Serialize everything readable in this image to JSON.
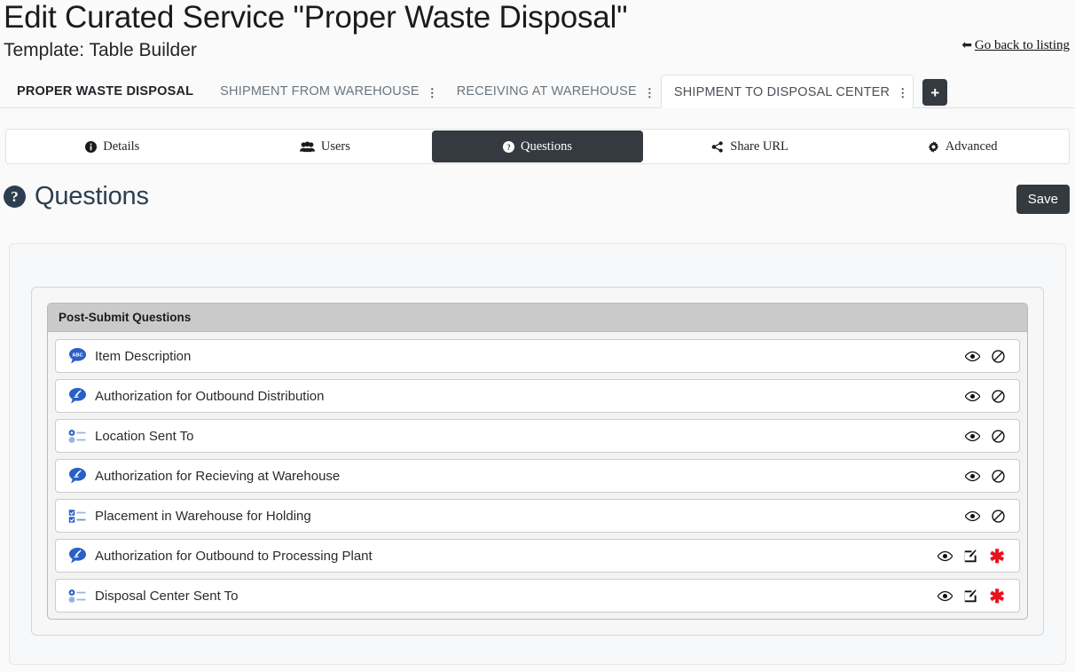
{
  "header": {
    "title": "Edit Curated Service \"Proper Waste Disposal\"",
    "subtitle": "Template: Table Builder",
    "go_back_label": "Go back to listing",
    "back_arrow_icon": "arrow-left-icon"
  },
  "tabs": {
    "items": [
      {
        "label": "PROPER WASTE DISPOSAL",
        "kebab": false,
        "style": "bold",
        "active": false
      },
      {
        "label": "SHIPMENT FROM WAREHOUSE",
        "kebab": true,
        "style": "muted",
        "active": false
      },
      {
        "label": "RECEIVING AT WAREHOUSE",
        "kebab": true,
        "style": "muted",
        "active": false
      },
      {
        "label": "SHIPMENT TO DISPOSAL CENTER",
        "kebab": true,
        "style": "muted",
        "active": true
      }
    ],
    "kebab_glyph": "⋮",
    "add_tab_label": "+",
    "add_tab_icon": "plus-icon"
  },
  "nav": {
    "items": [
      {
        "label": "Details",
        "icon": "info-circle-icon",
        "active": false
      },
      {
        "label": "Users",
        "icon": "users-icon",
        "active": false
      },
      {
        "label": "Questions",
        "icon": "question-circle-icon",
        "active": true
      },
      {
        "label": "Share URL",
        "icon": "share-icon",
        "active": false
      },
      {
        "label": "Advanced",
        "icon": "gear-icon",
        "active": false
      }
    ]
  },
  "section": {
    "title": "Questions",
    "badge_icon": "question-circle-icon",
    "badge_glyph": "?",
    "save_label": "Save"
  },
  "panel": {
    "header": "Post-Submit Questions",
    "rows": [
      {
        "label": "Item Description",
        "icon": "text-question-icon",
        "actions": [
          "eye-icon",
          "ban-icon"
        ]
      },
      {
        "label": "Authorization for Outbound Distribution",
        "icon": "signature-question-icon",
        "actions": [
          "eye-icon",
          "ban-icon"
        ]
      },
      {
        "label": "Location Sent To",
        "icon": "radio-list-icon",
        "actions": [
          "eye-icon",
          "ban-icon"
        ]
      },
      {
        "label": "Authorization for Recieving at Warehouse",
        "icon": "signature-question-icon",
        "actions": [
          "eye-icon",
          "ban-icon"
        ]
      },
      {
        "label": "Placement in Warehouse for Holding",
        "icon": "checkbox-list-icon",
        "actions": [
          "eye-icon",
          "ban-icon"
        ]
      },
      {
        "label": "Authorization for Outbound to Processing Plant",
        "icon": "signature-question-icon",
        "actions": [
          "eye-icon",
          "edit-icon",
          "required-asterisk-icon"
        ]
      },
      {
        "label": "Disposal Center Sent To",
        "icon": "radio-list-icon",
        "actions": [
          "eye-icon",
          "edit-icon",
          "required-asterisk-icon"
        ]
      }
    ]
  },
  "colors": {
    "page_background": "#fafafa",
    "dark": "#343a40",
    "panel_header": "#cacaca",
    "icon_blue": "#2a5fc8",
    "required_red": "#e8111c",
    "heading": "#2c3e50"
  }
}
